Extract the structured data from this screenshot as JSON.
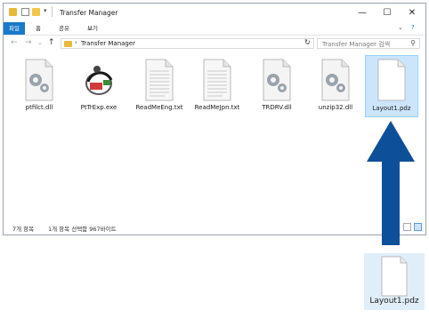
{
  "window": {
    "title": "Transfer Manager",
    "controls": {
      "minimize": "—",
      "maximize": "☐",
      "close": "✕"
    }
  },
  "ribbon": {
    "tabs": [
      "파일",
      "홈",
      "공유",
      "보기"
    ],
    "collapse_glyph": "⌄",
    "help_glyph": "?"
  },
  "address": {
    "breadcrumb": "Transfer Manager",
    "search_placeholder": "Transfer Manager 검색"
  },
  "files": [
    {
      "name": "ptfilct.dll",
      "icon": "dll-gear-icon",
      "selected": false
    },
    {
      "name": "PtTrExp.exe",
      "icon": "exe-app-icon",
      "selected": false
    },
    {
      "name": "ReadMeEng.txt",
      "icon": "text-doc-icon",
      "selected": false
    },
    {
      "name": "ReadMeJpn.txt",
      "icon": "text-doc-icon",
      "selected": false
    },
    {
      "name": "TRDRV.dll",
      "icon": "dll-gear-icon",
      "selected": false
    },
    {
      "name": "unzip32.dll",
      "icon": "dll-gear-icon",
      "selected": false
    },
    {
      "name": "Layout1.pdz",
      "icon": "blank-doc-icon",
      "selected": true
    }
  ],
  "status": {
    "count": "7개 항목",
    "selection": "1개 항목 선택함 967바이트"
  },
  "callout": {
    "label": "Layout1.pdz"
  },
  "colors": {
    "accent": "#1979ca",
    "arrow": "#0e4f9a",
    "selection": "#cce5fb"
  }
}
